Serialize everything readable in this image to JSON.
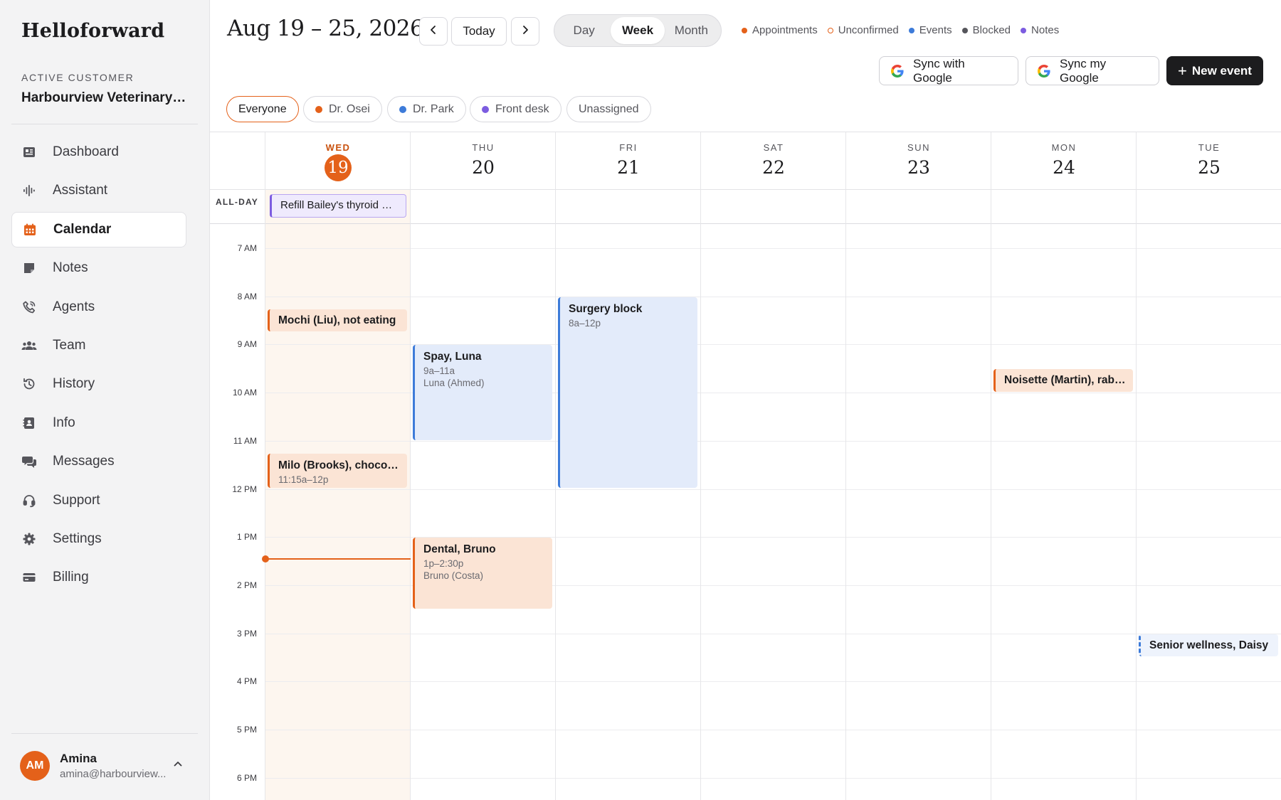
{
  "app": {
    "brand": "Helloforward"
  },
  "customer": {
    "label": "ACTIVE CUSTOMER",
    "name": "Harbourview Veterinary Clinic"
  },
  "nav": [
    {
      "label": "Dashboard",
      "icon": "dashboard-icon"
    },
    {
      "label": "Assistant",
      "icon": "waveform-icon"
    },
    {
      "label": "Calendar",
      "icon": "calendar-icon",
      "active": true
    },
    {
      "label": "Notes",
      "icon": "note-icon"
    },
    {
      "label": "Agents",
      "icon": "phone-icon"
    },
    {
      "label": "Team",
      "icon": "team-icon"
    },
    {
      "label": "History",
      "icon": "history-icon"
    },
    {
      "label": "Info",
      "icon": "contact-card-icon"
    },
    {
      "label": "Messages",
      "icon": "chat-icon"
    },
    {
      "label": "Support",
      "icon": "headset-icon"
    },
    {
      "label": "Settings",
      "icon": "gear-icon"
    },
    {
      "label": "Billing",
      "icon": "credit-card-icon"
    }
  ],
  "user": {
    "initials": "AM",
    "name": "Amina",
    "email": "amina@harbourview..."
  },
  "header": {
    "range": "Aug 19 – 25, 2026",
    "today_label": "Today",
    "views": [
      "Day",
      "Week",
      "Month"
    ],
    "active_view": "Week",
    "legend": [
      {
        "label": "Appointments",
        "color": "#e4611a",
        "style": "solid"
      },
      {
        "label": "Unconfirmed",
        "color": "#e4611a",
        "style": "ring"
      },
      {
        "label": "Events",
        "color": "#3d7bd9",
        "style": "solid"
      },
      {
        "label": "Blocked",
        "color": "#55555b",
        "style": "solid"
      },
      {
        "label": "Notes",
        "color": "#7c5ce0",
        "style": "solid"
      }
    ],
    "sync_google_label": "Sync with Google",
    "sync_my_google_label": "Sync my Google",
    "new_event_label": "New event"
  },
  "filters": [
    {
      "label": "Everyone",
      "active": true
    },
    {
      "label": "Dr. Osei",
      "color": "#e4611a"
    },
    {
      "label": "Dr. Park",
      "color": "#3d7bd9"
    },
    {
      "label": "Front desk",
      "color": "#7c5ce0"
    },
    {
      "label": "Unassigned"
    }
  ],
  "calendar": {
    "allday_label": "ALL-DAY",
    "days": [
      {
        "name": "WED",
        "num": "19",
        "today": true
      },
      {
        "name": "THU",
        "num": "20"
      },
      {
        "name": "FRI",
        "num": "21"
      },
      {
        "name": "SAT",
        "num": "22"
      },
      {
        "name": "SUN",
        "num": "23"
      },
      {
        "name": "MON",
        "num": "24"
      },
      {
        "name": "TUE",
        "num": "25"
      }
    ],
    "hours": [
      "7 AM",
      "8 AM",
      "9 AM",
      "10 AM",
      "11 AM",
      "12 PM",
      "1 PM",
      "2 PM",
      "3 PM",
      "4 PM",
      "5 PM",
      "6 PM"
    ],
    "allday_events": [
      {
        "day": 0,
        "title": "Refill Bailey's thyroid medication",
        "kind": "note"
      }
    ],
    "events": [
      {
        "day": 0,
        "title": "Mochi (Liu), not eating",
        "sub1": "",
        "sub2": "",
        "start": 8.25,
        "end": 8.75,
        "kind": "appt"
      },
      {
        "day": 0,
        "title": "Milo (Brooks), chocolate ingestion",
        "sub1": "11:15a–12p",
        "sub2": "",
        "start": 11.25,
        "end": 12.0,
        "kind": "appt"
      },
      {
        "day": 1,
        "title": "Spay, Luna",
        "sub1": "9a–11a",
        "sub2": "Luna (Ahmed)",
        "start": 9.0,
        "end": 11.0,
        "kind": "event"
      },
      {
        "day": 1,
        "title": "Dental, Bruno",
        "sub1": "1p–2:30p",
        "sub2": "Bruno (Costa)",
        "start": 13.0,
        "end": 14.5,
        "kind": "appt"
      },
      {
        "day": 2,
        "title": "Surgery block",
        "sub1": "8a–12p",
        "sub2": "",
        "start": 8.0,
        "end": 12.0,
        "kind": "event"
      },
      {
        "day": 5,
        "title": "Noisette (Martin), rabbit checkup",
        "sub1": "",
        "sub2": "",
        "start": 9.5,
        "end": 10.0,
        "kind": "appt"
      },
      {
        "day": 6,
        "title": "Senior wellness, Daisy",
        "sub1": "",
        "sub2": "",
        "start": 15.0,
        "end": 15.5,
        "kind": "dashed"
      }
    ],
    "now": {
      "day": 0,
      "hour": 13.45
    }
  }
}
